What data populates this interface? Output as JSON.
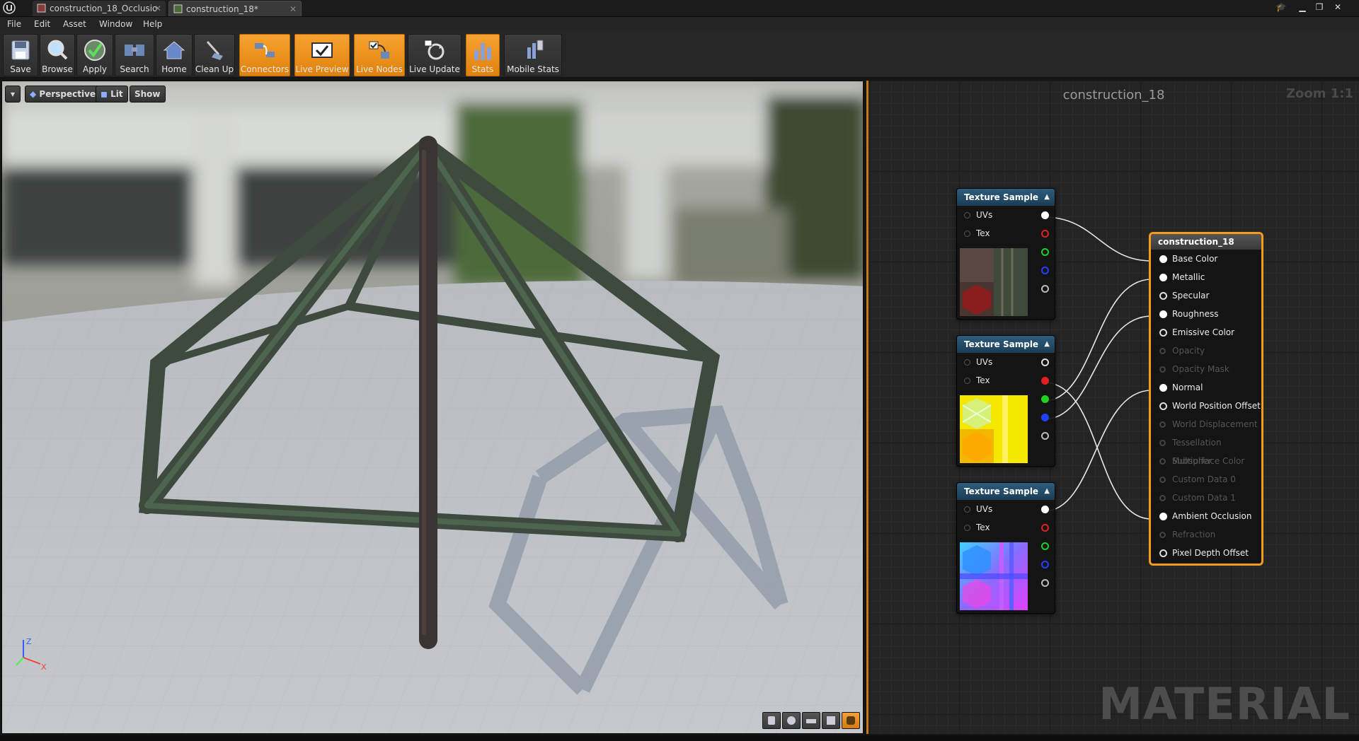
{
  "tabs": [
    {
      "label": "construction_18_Occlusio",
      "active": false
    },
    {
      "label": "construction_18*",
      "active": true
    }
  ],
  "menu": [
    "File",
    "Edit",
    "Asset",
    "Window",
    "Help"
  ],
  "toolbar": [
    {
      "label": "Save",
      "icon": "save-icon",
      "active": false
    },
    {
      "label": "Browse",
      "icon": "browse-icon",
      "active": false
    },
    {
      "label": "Apply",
      "icon": "apply-icon",
      "active": false
    },
    {
      "label": "Search",
      "icon": "search-icon",
      "active": false
    },
    {
      "label": "Home",
      "icon": "home-icon",
      "active": false
    },
    {
      "label": "Clean Up",
      "icon": "clean-up-icon",
      "active": false
    },
    {
      "label": "Connectors",
      "icon": "connectors-icon",
      "active": true
    },
    {
      "label": "Live Preview",
      "icon": "live-preview-icon",
      "active": true
    },
    {
      "label": "Live Nodes",
      "icon": "live-nodes-icon",
      "active": true
    },
    {
      "label": "Live Update",
      "icon": "live-update-icon",
      "active": false
    },
    {
      "label": "Stats",
      "icon": "stats-icon",
      "active": true
    },
    {
      "label": "Mobile Stats",
      "icon": "mobile-stats-icon",
      "active": false
    }
  ],
  "viewport": {
    "perspective_label": "Perspective",
    "lit_label": "Lit",
    "show_label": "Show",
    "axis_z": "Z",
    "axis_x": "X"
  },
  "graph": {
    "title": "construction_18",
    "zoom": "Zoom 1:1",
    "watermark": "MATERIAL",
    "texture_nodes": [
      {
        "title": "Texture Sample",
        "uvs": "UVs",
        "tex": "Tex",
        "thumbnail": "occlusion-roughness-metallic"
      },
      {
        "title": "Texture Sample",
        "uvs": "UVs",
        "tex": "Tex",
        "thumbnail": "base-color"
      },
      {
        "title": "Texture Sample",
        "uvs": "UVs",
        "tex": "Tex",
        "thumbnail": "normal-map"
      }
    ],
    "result_node": {
      "title": "construction_18",
      "inputs": [
        {
          "label": "Base Color",
          "enabled": true,
          "connected": true
        },
        {
          "label": "Metallic",
          "enabled": true,
          "connected": true
        },
        {
          "label": "Specular",
          "enabled": true,
          "connected": false
        },
        {
          "label": "Roughness",
          "enabled": true,
          "connected": true
        },
        {
          "label": "Emissive Color",
          "enabled": true,
          "connected": false
        },
        {
          "label": "Opacity",
          "enabled": false,
          "connected": false
        },
        {
          "label": "Opacity Mask",
          "enabled": false,
          "connected": false
        },
        {
          "label": "Normal",
          "enabled": true,
          "connected": true
        },
        {
          "label": "World Position Offset",
          "enabled": true,
          "connected": false
        },
        {
          "label": "World Displacement",
          "enabled": false,
          "connected": false
        },
        {
          "label": "Tessellation Multiplier",
          "enabled": false,
          "connected": false
        },
        {
          "label": "Subsurface Color",
          "enabled": false,
          "connected": false
        },
        {
          "label": "Custom Data 0",
          "enabled": false,
          "connected": false
        },
        {
          "label": "Custom Data 1",
          "enabled": false,
          "connected": false
        },
        {
          "label": "Ambient Occlusion",
          "enabled": true,
          "connected": true
        },
        {
          "label": "Refraction",
          "enabled": false,
          "connected": false
        },
        {
          "label": "Pixel Depth Offset",
          "enabled": true,
          "connected": false
        }
      ]
    }
  },
  "colors": {
    "accent": "#f59c1f",
    "node_header": "#2d5c7c",
    "pin_red": "#e02020",
    "pin_green": "#20d020",
    "pin_blue": "#2040ff"
  }
}
